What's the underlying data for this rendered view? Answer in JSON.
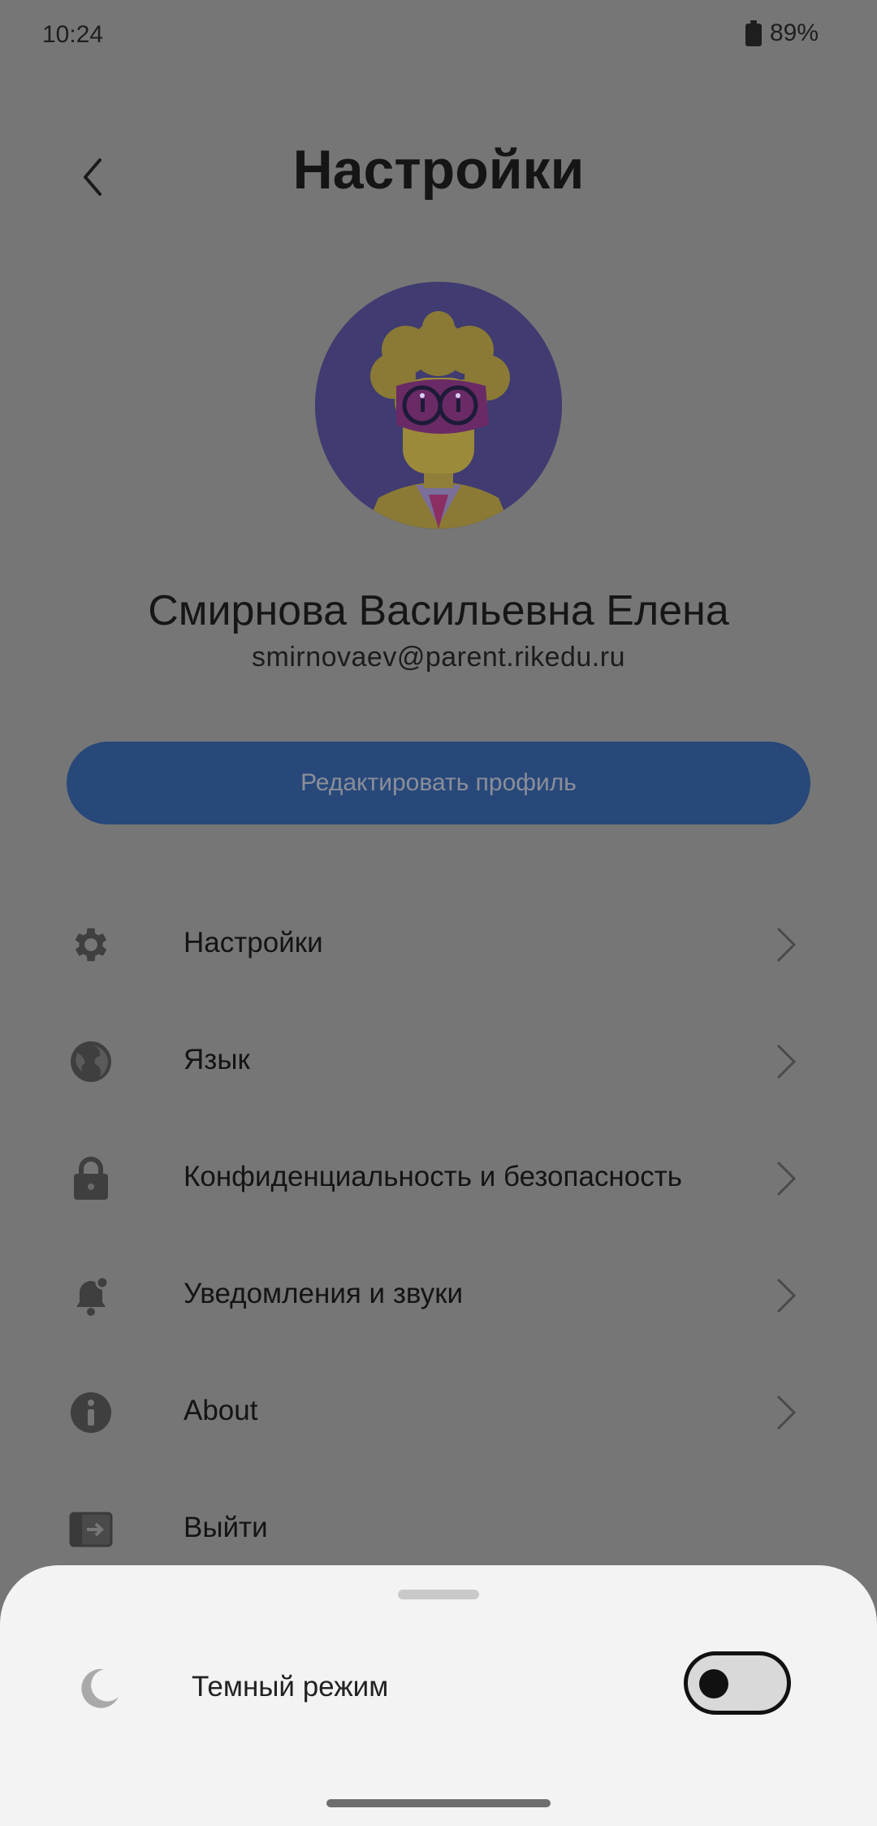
{
  "status": {
    "time": "10:24",
    "battery": "89%"
  },
  "header": {
    "title": "Настройки"
  },
  "profile": {
    "name": "Смирнова Васильевна Елена",
    "email": "smirnovaev@parent.rikedu.ru",
    "edit_label": "Редактировать профиль"
  },
  "menu": [
    {
      "label": "Настройки",
      "icon": "gear-icon"
    },
    {
      "label": "Язык",
      "icon": "globe-icon"
    },
    {
      "label": "Конфиденциальность и безопасность",
      "icon": "lock-icon"
    },
    {
      "label": "Уведомления и звуки",
      "icon": "bell-icon"
    },
    {
      "label": "About",
      "icon": "info-icon"
    },
    {
      "label": "Выйти",
      "icon": "logout-icon"
    }
  ],
  "sheet": {
    "dark_mode_label": "Темный режим",
    "dark_mode_on": false
  },
  "colors": {
    "accent": "#28487a",
    "scrim": "#767676",
    "sheet": "#f3f3f3"
  }
}
